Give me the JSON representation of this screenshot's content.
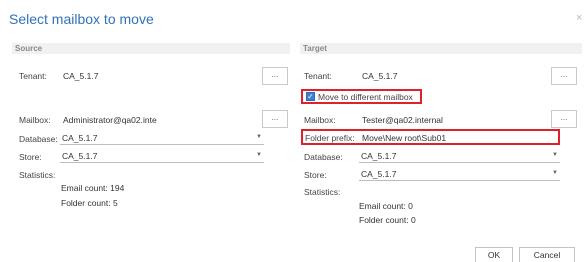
{
  "dialog": {
    "title": "Select mailbox to move",
    "close_glyph": "×"
  },
  "source": {
    "header": "Source",
    "tenant_label": "Tenant:",
    "tenant_value": "CA_5.1.7",
    "tenant_browse": "...",
    "mailbox_label": "Mailbox:",
    "mailbox_value": "Administrator@qa02.inte",
    "mailbox_browse": "...",
    "database_label": "Database:",
    "database_value": "CA_5.1.7",
    "store_label": "Store:",
    "store_value": "CA_5.1.7",
    "statistics_label": "Statistics:",
    "email_count": "Email count: 194",
    "folder_count": "Folder count: 5"
  },
  "target": {
    "header": "Target",
    "tenant_label": "Tenant:",
    "tenant_value": "CA_5.1.7",
    "tenant_browse": "...",
    "move_checkbox_label": "Move to different mailbox",
    "move_checked": true,
    "mailbox_label": "Mailbox:",
    "mailbox_value": "Tester@qa02.internal",
    "mailbox_browse": "...",
    "folder_prefix_label": "Folder prefix:",
    "folder_prefix_value": "Move\\New root\\Sub01",
    "database_label": "Database:",
    "database_value": "CA_5.1.7",
    "store_label": "Store:",
    "store_value": "CA_5.1.7",
    "statistics_label": "Statistics:",
    "email_count": "Email count: 0",
    "folder_count": "Folder count: 0"
  },
  "footer": {
    "ok_label": "OK",
    "cancel_label": "Cancel"
  },
  "colors": {
    "title": "#2f73b8",
    "highlight": "#e0202a",
    "checkbox": "#3b7fd0"
  },
  "icons": {
    "dropdown": "chevron-down-icon",
    "checkbox": "checkmark-icon",
    "close": "close-icon"
  }
}
